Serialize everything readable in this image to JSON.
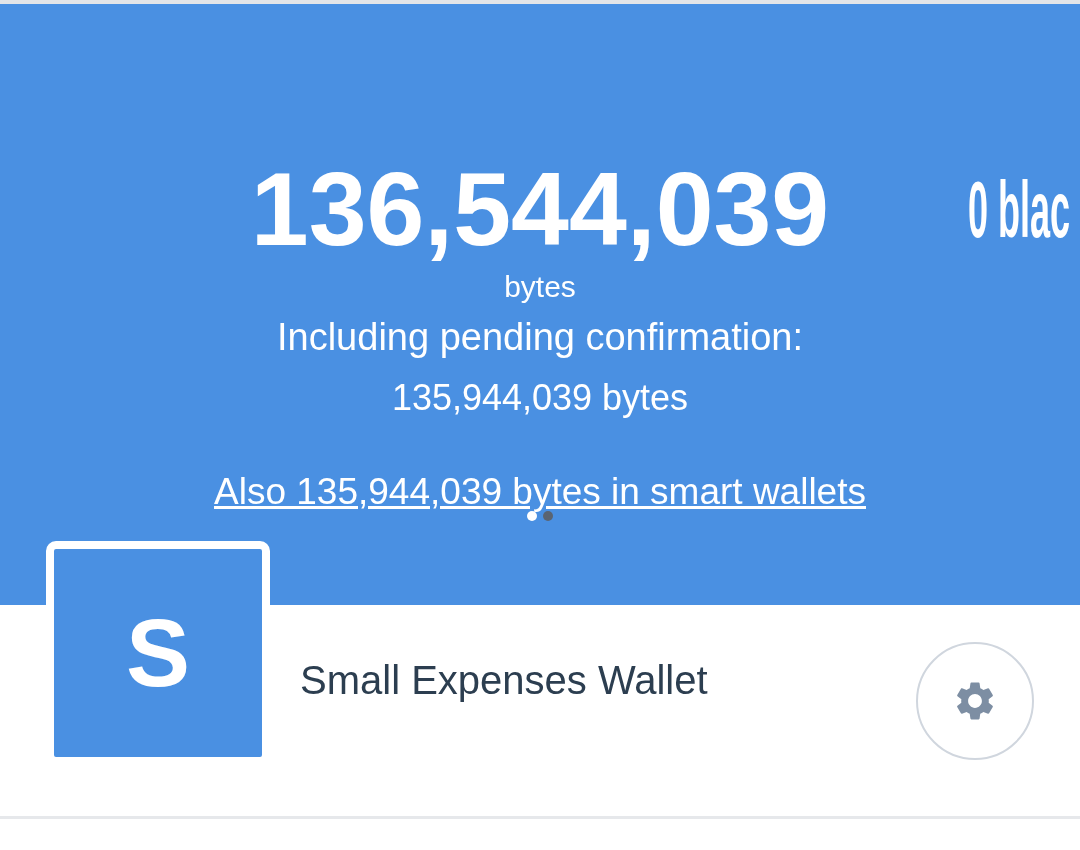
{
  "balance": {
    "amount": "136,544,039",
    "unit": "bytes",
    "pending_label": "Including pending confirmation:",
    "pending_amount": "135,944,039 bytes",
    "smart_wallets_link": "Also 135,944,039 bytes in smart wallets"
  },
  "next_slide": {
    "amount": "0 blac"
  },
  "pager": [
    {
      "selected": true
    },
    {
      "selected": false
    }
  ],
  "wallet": {
    "initial": "S",
    "name": "Small Expenses Wallet"
  }
}
